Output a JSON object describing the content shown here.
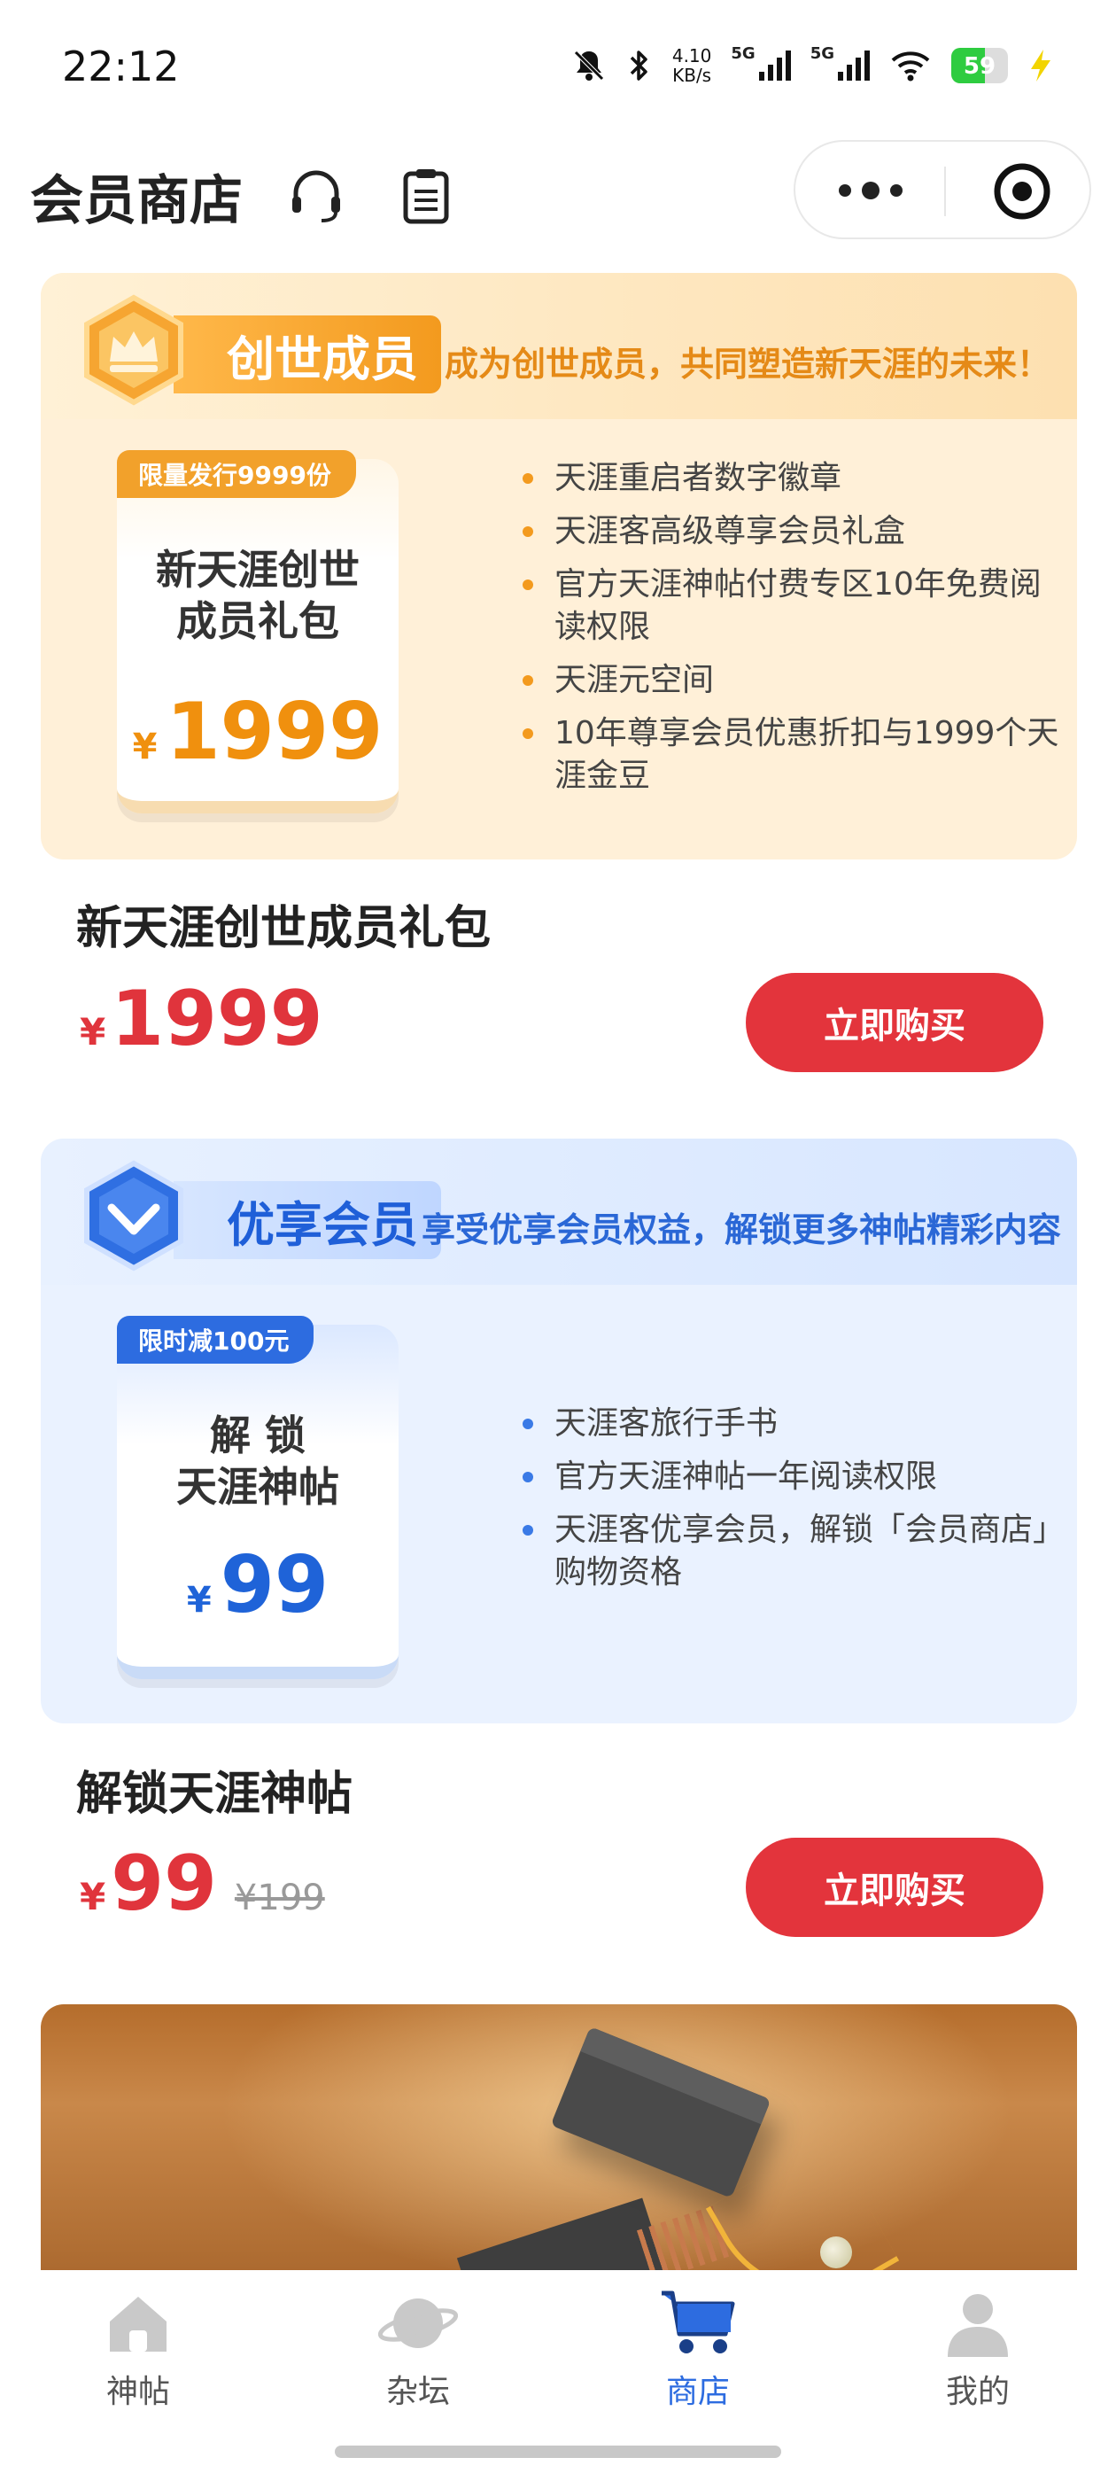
{
  "status_bar": {
    "time": "22:12",
    "speed_value": "4.10",
    "speed_unit": "KB/s",
    "net1": "5G",
    "net2": "5G",
    "battery": "59",
    "battery_level": 0.59
  },
  "header": {
    "title": "会员商店"
  },
  "products": [
    {
      "badge_label": "创世成员",
      "slogan": "成为创世成员，共同塑造新天涯的未来！",
      "ticket_flag": "限量发行9999份",
      "ticket_name": "新天涯创世\n成员礼包",
      "ticket_currency": "¥",
      "ticket_price": "1999",
      "features": [
        "天涯重启者数字徽章",
        "天涯客高级尊享会员礼盒",
        "官方天涯神帖付费专区10年免费阅读权限",
        "天涯元空间",
        "10年尊享会员优惠折扣与1999个天涯金豆"
      ],
      "title": "新天涯创世成员礼包",
      "currency": "¥",
      "price": "1999",
      "original_price": "",
      "buy_label": "立即购买"
    },
    {
      "badge_label": "优享会员",
      "slogan": "享受优享会员权益，解锁更多神帖精彩内容",
      "ticket_flag": "限时减100元",
      "ticket_name": "解 锁\n天涯神帖",
      "ticket_currency": "¥",
      "ticket_price": "99",
      "features": [
        "天涯客旅行手书",
        "官方天涯神帖一年阅读权限",
        "天涯客优享会员，解锁「会员商店」购物资格"
      ],
      "title": "解锁天涯神帖",
      "currency": "¥",
      "price": "99",
      "original_price": "¥199",
      "buy_label": "立即购买"
    }
  ],
  "tabbar": {
    "items": [
      {
        "label": "神帖",
        "icon": "house-icon"
      },
      {
        "label": "杂坛",
        "icon": "planet-icon"
      },
      {
        "label": "商店",
        "icon": "cart-icon",
        "active": true
      },
      {
        "label": "我的",
        "icon": "person-icon"
      }
    ]
  },
  "colors": {
    "accent_red": "#e3343c",
    "gold": "#f39a1e",
    "blue": "#2d6ce0"
  }
}
